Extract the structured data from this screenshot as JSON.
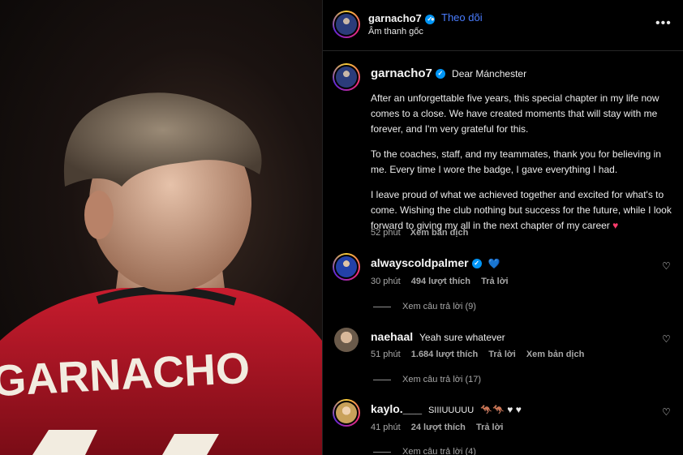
{
  "header": {
    "username": "garnacho7",
    "follow_label": "Theo dõi",
    "audio_label": "Âm thanh gốc",
    "more_label": "•••"
  },
  "post": {
    "username": "garnacho7",
    "title": "Dear Mánchester",
    "paragraphs": [
      "After an unforgettable five years, this special chapter in my life now comes to a close. We have created moments that will stay with me forever, and I'm very grateful for this.",
      "To the coaches, staff, and my teammates, thank you for believing in me. Every time I wore the badge, I gave everything I had.",
      "I leave proud of what we achieved together and excited for what's to come. Wishing the club nothing but success for the future, while I look forward to giving my all in the next chapter of my career"
    ],
    "heart_emoji": "♥",
    "time": "52 phút",
    "translate_label": "Xem bản dịch"
  },
  "media": {
    "jersey_text": "GARNACHO"
  },
  "comments": [
    {
      "username": "alwayscoldpalmer",
      "text": "",
      "emoji": "💙",
      "time": "30 phút",
      "likes": "494 lượt thích",
      "reply_label": "Trả lời",
      "translate_label": "",
      "view_replies": "Xem câu trả lời (9)"
    },
    {
      "username": "naehaal",
      "text": "Yeah sure whatever",
      "emoji": "",
      "time": "51 phút",
      "likes": "1.684 lượt thích",
      "reply_label": "Trả lời",
      "translate_label": "Xem bản dịch",
      "view_replies": "Xem câu trả lời (17)"
    },
    {
      "username": "kaylo.___",
      "text": "SIIIUUUUU",
      "emoji": "🦘🦘 ♥ ♥",
      "time": "41 phút",
      "likes": "24 lượt thích",
      "reply_label": "Trả lời",
      "translate_label": "",
      "view_replies": "Xem câu trả lời (4)"
    }
  ],
  "icons": {
    "verified": "verified-check-icon",
    "like": "heart-outline-icon",
    "more": "more-horizontal-icon"
  },
  "colors": {
    "follow": "#4a7dff",
    "verified": "#0095f6",
    "jersey": "#c8102e"
  }
}
